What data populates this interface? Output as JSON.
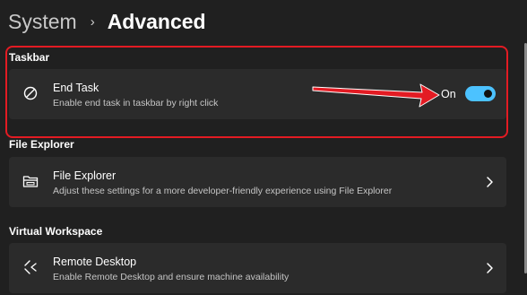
{
  "breadcrumb": {
    "parent": "System",
    "separator": "›",
    "current": "Advanced"
  },
  "sections": {
    "taskbar": {
      "title": "Taskbar",
      "end_task": {
        "title": "End Task",
        "description": "Enable end task in taskbar by right click",
        "toggle_label": "On",
        "toggle_on": true,
        "icon": "block-icon"
      }
    },
    "file_explorer": {
      "title": "File Explorer",
      "item": {
        "title": "File Explorer",
        "description": "Adjust these settings for a more developer-friendly experience using File Explorer",
        "icon": "folder-icon"
      }
    },
    "virtual_workspace": {
      "title": "Virtual Workspace",
      "item": {
        "title": "Remote Desktop",
        "description": "Enable Remote Desktop and ensure machine availability",
        "icon": "remote-desktop-icon"
      }
    }
  },
  "colors": {
    "background": "#202020",
    "card": "#2b2b2b",
    "accent": "#4cc2ff",
    "annotation": "#e31b23"
  }
}
